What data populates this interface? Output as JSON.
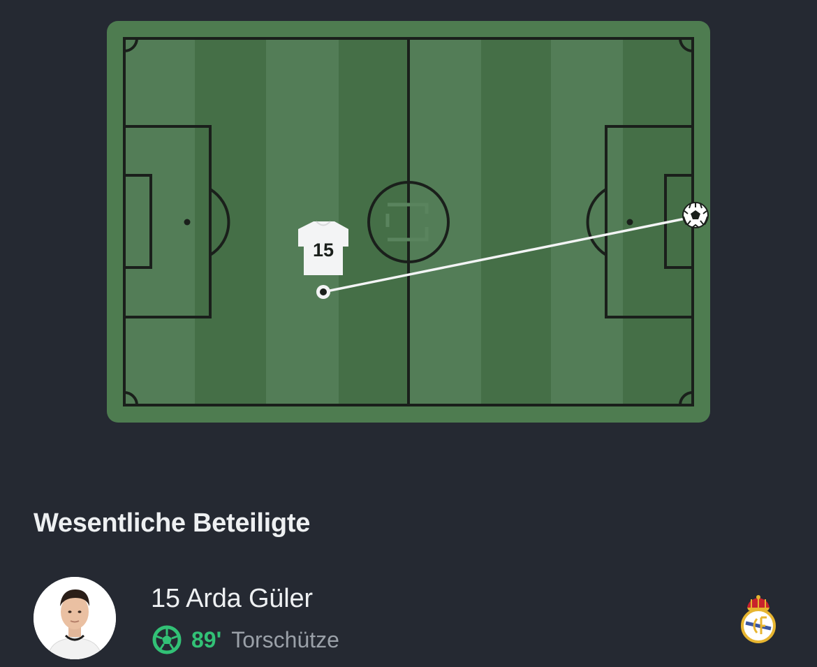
{
  "pitch": {
    "jersey_number": "15",
    "colors": {
      "border": "#4e7c50",
      "stripe_light": "#537d57",
      "stripe_dark": "#456f47",
      "lines": "#1a1f1b",
      "shot_line": "#f3f4f5"
    }
  },
  "section": {
    "title": "Wesentliche Beteiligte"
  },
  "player": {
    "name": "15 Arda Güler",
    "event_minute": "89'",
    "event_type": "Torschütze",
    "event_icon": "soccer-ball-icon",
    "club_icon": "real-madrid-crest-icon",
    "colors": {
      "minute": "#32c176",
      "event_type": "#9aa0a8"
    }
  }
}
